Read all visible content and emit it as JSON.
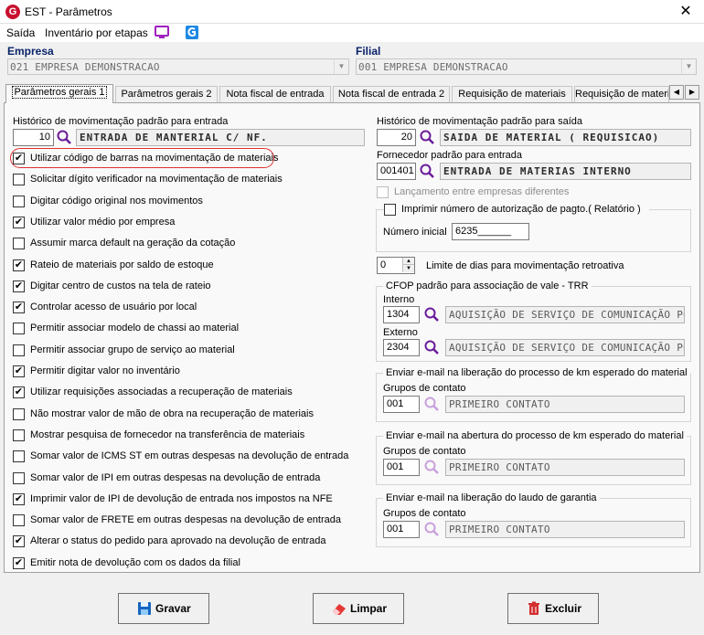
{
  "window": {
    "title": "EST - Parâmetros",
    "app_icon_letter": "G"
  },
  "menu": {
    "saida": "Saída",
    "inventario": "Inventário por etapas"
  },
  "empresa": {
    "label": "Empresa",
    "value": "021 EMPRESA DEMONSTRACAO"
  },
  "filial": {
    "label": "Filial",
    "value": "001 EMPRESA DEMONSTRACAO"
  },
  "tabs": [
    "Parâmetros gerais 1",
    "Parâmetros gerais 2",
    "Nota fiscal de entrada",
    "Nota fiscal de entrada 2",
    "Requisição de materiais",
    "Requisição de materi"
  ],
  "left": {
    "hist_entrada_label": "Histórico de movimentação padrão para entrada",
    "hist_entrada_code": "10",
    "hist_entrada_desc": "ENTRADA DE MANTERIAL C/ NF.",
    "checkboxes": [
      {
        "label": "Utilizar código de barras na movimentação de materiais",
        "checked": true
      },
      {
        "label": "Solicitar dígito verificador na movimentação de materiais",
        "checked": false
      },
      {
        "label": "Digitar código original nos movimentos",
        "checked": false
      },
      {
        "label": "Utilizar valor médio por empresa",
        "checked": true
      },
      {
        "label": "Assumir marca default na geração da cotação",
        "checked": false
      },
      {
        "label": "Rateio de materiais por saldo de estoque",
        "checked": true
      },
      {
        "label": "Digitar centro de custos na tela de rateio",
        "checked": true
      },
      {
        "label": "Controlar acesso de usuário por local",
        "checked": true
      },
      {
        "label": "Permitir associar modelo de chassi ao material",
        "checked": false
      },
      {
        "label": "Permitir associar grupo de serviço ao material",
        "checked": false
      },
      {
        "label": "Permitir digitar valor no inventário",
        "checked": true
      },
      {
        "label": "Utilizar requisições associadas a recuperação de materiais",
        "checked": true
      },
      {
        "label": "Não mostrar valor de mão de obra na recuperação de materiais",
        "checked": false
      },
      {
        "label": "Mostrar pesquisa de fornecedor na transferência de materiais",
        "checked": false
      },
      {
        "label": "Somar valor de ICMS ST em outras despesas na devolução de entrada",
        "checked": false
      },
      {
        "label": "Somar valor de IPI em outras despesas na devolução de entrada",
        "checked": false
      },
      {
        "label": "Imprimir valor de IPI de devolução de entrada nos impostos na NFE",
        "checked": true
      },
      {
        "label": "Somar valor de FRETE em outras despesas na devolução de entrada",
        "checked": false
      },
      {
        "label": "Alterar o status do pedido para aprovado na devolução de entrada",
        "checked": true
      },
      {
        "label": "Emitir nota de devolução com os dados da filial",
        "checked": true
      }
    ]
  },
  "right": {
    "hist_saida_label": "Histórico de movimentação padrão para saída",
    "hist_saida_code": "20",
    "hist_saida_desc": "SAIDA DE MATERIAL ( REQUISICAO)",
    "fornecedor_label": "Fornecedor padrão para entrada",
    "fornecedor_code": "001401",
    "fornecedor_desc": "ENTRADA DE MATERIAS  INTERNO",
    "lancamento_label": "Lançamento entre empresas diferentes",
    "lancamento_checked": false,
    "imprimir_label": "Imprimir número de autorização de pagto.( Relatório )",
    "imprimir_checked": false,
    "numero_inicial_label": "Número inicial",
    "numero_inicial_value": "6235______",
    "limite_value": "0",
    "limite_label": "Limite de dias para movimentação retroativa",
    "cfop_title": "CFOP padrão para associação de vale - TRR",
    "interno_label": "Interno",
    "interno_code": "1304",
    "interno_desc": "AQUISIÇÃO DE SERVIÇO DE COMUNICAÇÃO POR I",
    "externo_label": "Externo",
    "externo_code": "2304",
    "externo_desc": "AQUISIÇÃO DE SERVIÇO DE COMUNICAÇÃO POR I",
    "email_groups": [
      {
        "title": "Enviar e-mail na liberação do processo de km esperado do material",
        "grupos_label": "Grupos de contato",
        "code": "001",
        "desc": "PRIMEIRO CONTATO"
      },
      {
        "title": "Enviar e-mail na abertura do processo de km esperado do material",
        "grupos_label": "Grupos de contato",
        "code": "001",
        "desc": "PRIMEIRO CONTATO"
      },
      {
        "title": "Enviar e-mail na liberação do laudo de garantia",
        "grupos_label": "Grupos de contato",
        "code": "001",
        "desc": "PRIMEIRO CONTATO"
      }
    ]
  },
  "buttons": {
    "gravar": "Gravar",
    "limpar": "Limpar",
    "excluir": "Excluir"
  },
  "colors": {
    "brand_red": "#c8102e",
    "label_blue": "#0a246a",
    "highlight": "#e03030",
    "search_purple": "#6a1b9a"
  }
}
